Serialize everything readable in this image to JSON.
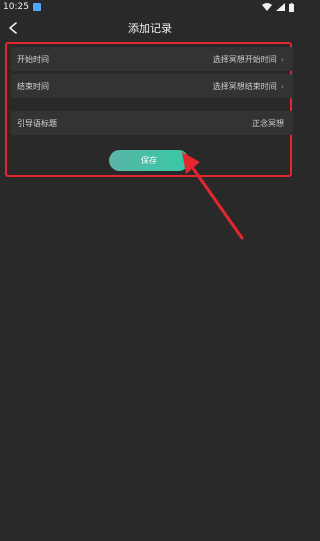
{
  "status_bar": {
    "time": "10:25"
  },
  "header": {
    "title": "添加记录"
  },
  "form": {
    "rows": [
      {
        "label": "开始时间",
        "value": "选择冥想开始时间"
      },
      {
        "label": "结束时间",
        "value": "选择冥想结束时间"
      },
      {
        "label": "引导语标题",
        "value": "正念冥想"
      }
    ],
    "save_label": "保存"
  },
  "colors": {
    "highlight": "#e2282e",
    "save_gradient_start": "#59b5a7",
    "save_gradient_end": "#37c9a6"
  }
}
